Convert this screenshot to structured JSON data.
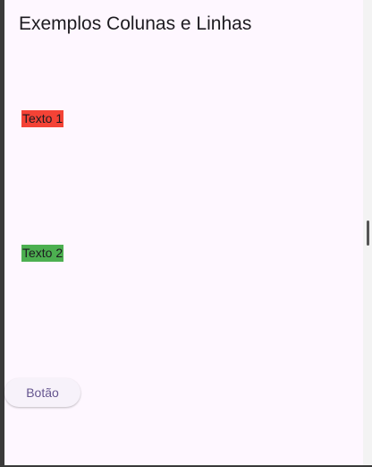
{
  "app_bar": {
    "title": "Exemplos Colunas e Linhas"
  },
  "column": {
    "items": [
      {
        "label": "Texto 1",
        "background": "#f44336"
      },
      {
        "label": "Texto 2",
        "background": "#4caf50"
      }
    ]
  },
  "button": {
    "label": "Botão"
  },
  "colors": {
    "surface": "#fef7ff",
    "button_text": "#65558f",
    "button_bg": "#f7f2fa"
  }
}
